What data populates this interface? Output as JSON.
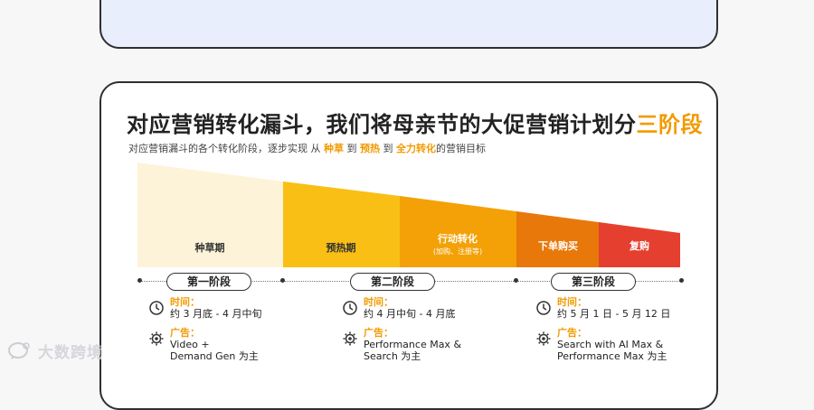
{
  "header": {
    "title_main": "对应营销转化漏斗，我们将母亲节的大促营销计划分",
    "title_highlight": "三阶段",
    "subtitle_prefix": "对应营销漏斗的各个转化阶段，逐步实现 从 ",
    "subtitle_k1": "种草",
    "subtitle_to1": " 到 ",
    "subtitle_k2": "预热",
    "subtitle_to2": " 到 ",
    "subtitle_k3": "全力转化",
    "subtitle_suffix": "的营销目标"
  },
  "funnel": {
    "segments": [
      {
        "label": "种草期",
        "sub": "",
        "color": "#fdf3d8"
      },
      {
        "label": "预热期",
        "sub": "",
        "color": "#f9bf15"
      },
      {
        "label": "行动转化",
        "sub": "(加购、注册等)",
        "color": "#f3a106"
      },
      {
        "label": "下单购买",
        "sub": "",
        "color": "#e8780a"
      },
      {
        "label": "复购",
        "sub": "",
        "color": "#e5402f"
      }
    ]
  },
  "stages": [
    {
      "name": "第一阶段",
      "time_label": "时间：",
      "time_value": "约 3 月底 - 4 月中旬",
      "ad_label": "广告：",
      "ad_line1": "Video +",
      "ad_line2": "Demand Gen 为主"
    },
    {
      "name": "第二阶段",
      "time_label": "时间：",
      "time_value": "约 4 月中旬 - 4 月底",
      "ad_label": "广告：",
      "ad_line1": "Performance Max &",
      "ad_line2": "Search 为主"
    },
    {
      "name": "第三阶段",
      "time_label": "时间：",
      "time_value": "约 5 月 1 日 - 5 月 12 日",
      "ad_label": "广告：",
      "ad_line1": "Search with AI Max &",
      "ad_line2": "Performance Max 为主"
    }
  ],
  "watermark": {
    "text": "大数跨境"
  },
  "colors": {
    "accent": "#f29a00",
    "border": "#2f2f33",
    "top_card_bg": "#e8eefc"
  }
}
